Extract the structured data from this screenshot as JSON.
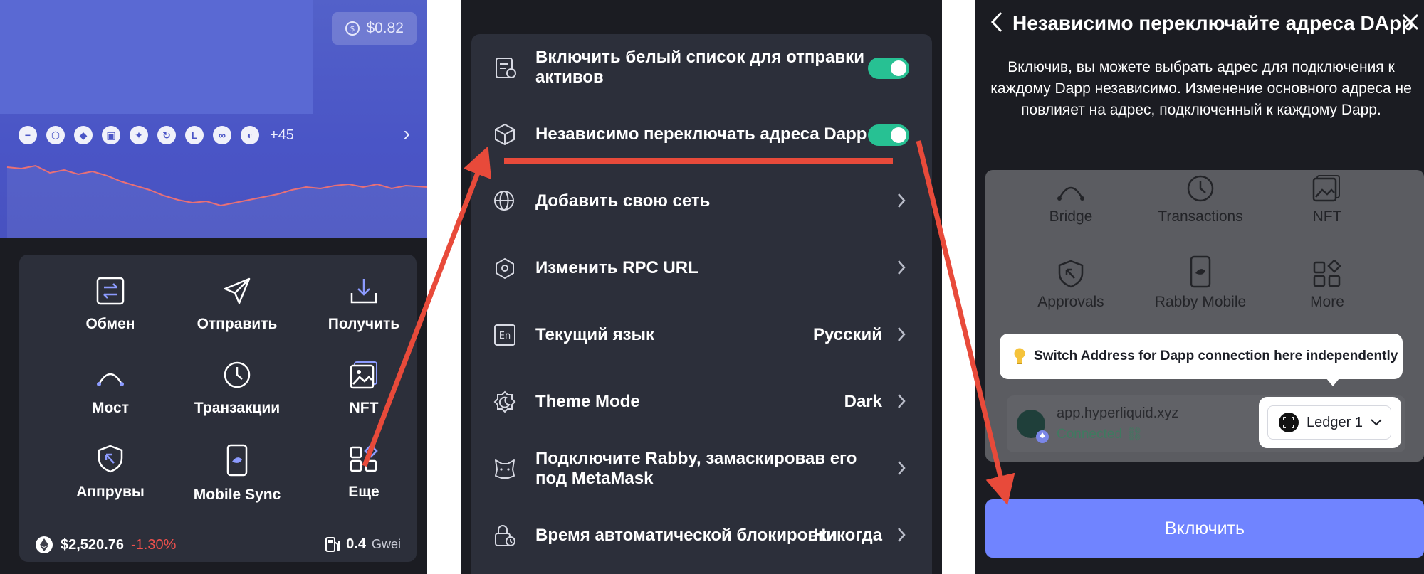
{
  "colors": {
    "background": "#1b1c22",
    "card": "#2c2f3a",
    "hero": "#4a55c6",
    "toggle_on": "#27c193",
    "accent_button": "#7084ff",
    "annotation_arrow": "#e84a3a",
    "negative": "#f0514d"
  },
  "wallet": {
    "balance_badge": "$0.82",
    "chains_more": "+45",
    "chains": [
      "circle-minus-icon",
      "hexagon-icon",
      "ethereum-icon",
      "cube-icon",
      "sparkle-icon",
      "refresh-coin-icon",
      "l-icon",
      "link-icon",
      "half-circle-icon"
    ],
    "menu": [
      {
        "label": "Обмен",
        "icon": "swap-icon"
      },
      {
        "label": "Отправить",
        "icon": "send-icon"
      },
      {
        "label": "Получить",
        "icon": "receive-icon"
      },
      {
        "label": "Мост",
        "icon": "bridge-icon"
      },
      {
        "label": "Транзакции",
        "icon": "clock-icon"
      },
      {
        "label": "NFT",
        "icon": "image-icon"
      },
      {
        "label": "Аппрувы",
        "icon": "shield-icon"
      },
      {
        "label": "Mobile Sync",
        "icon": "phone-icon"
      },
      {
        "label": "Еще",
        "icon": "grid-icon"
      }
    ],
    "eth_price": "$2,520.76",
    "eth_change": "-1.30%",
    "gas_value": "0.4",
    "gas_unit": "Gwei"
  },
  "settings": {
    "rows": [
      {
        "label": "Включить белый список для отправки активов",
        "type": "toggle",
        "on": true,
        "icon": "whitelist-icon"
      },
      {
        "label": "Независимо переключать адреса Dapp",
        "type": "toggle",
        "on": true,
        "icon": "box-switch-icon"
      },
      {
        "label": "Добавить свою сеть",
        "type": "link",
        "icon": "globe-edit-icon"
      },
      {
        "label": "Изменить RPC URL",
        "type": "link",
        "icon": "network-icon"
      },
      {
        "label": "Текущий язык",
        "type": "value",
        "value": "Русский",
        "icon": "language-icon"
      },
      {
        "label": "Theme Mode",
        "type": "value",
        "value": "Dark",
        "icon": "theme-icon"
      },
      {
        "label": "Подключите Rabby, замаскировав его под MetaMask",
        "type": "link",
        "icon": "fox-icon"
      },
      {
        "label": "Время автоматической блокировки",
        "type": "value",
        "value": "Никогда",
        "icon": "lock-clock-icon"
      }
    ]
  },
  "dialog": {
    "title": "Независимо переключайте адреса DApp",
    "description": "Включив, вы можете выбрать адрес для подключения к каждому Dapp независимо. Изменение основного адреса не повлияет на адрес, подключенный к каждому Dapp.",
    "preview_items": [
      {
        "label": "Bridge",
        "icon": "bridge-icon"
      },
      {
        "label": "Transactions",
        "icon": "clock-icon"
      },
      {
        "label": "NFT",
        "icon": "image-icon"
      },
      {
        "label": "Approvals",
        "icon": "shield-icon"
      },
      {
        "label": "Rabby Mobile",
        "icon": "phone-icon"
      },
      {
        "label": "More",
        "icon": "grid-icon"
      }
    ],
    "tip": "Switch Address for Dapp connection here independently",
    "dapp_name": "app.hyperliquid.xyz",
    "dapp_status": "Connected",
    "account": "Ledger 1",
    "enable_button": "Включить"
  }
}
